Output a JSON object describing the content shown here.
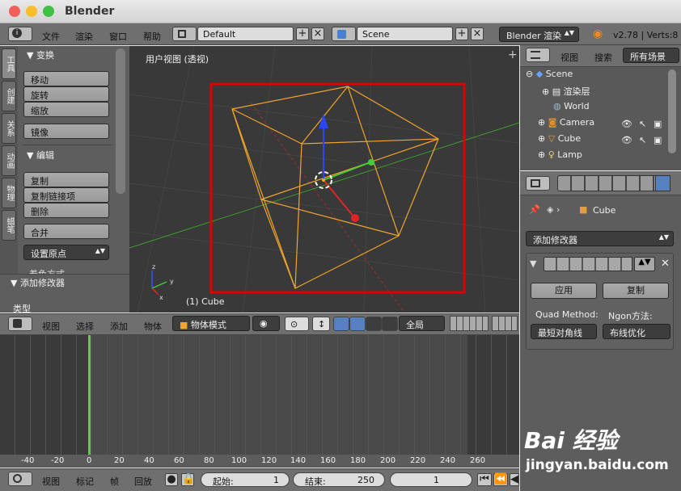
{
  "window": {
    "title": "Blender"
  },
  "colors": {
    "close": "#f25f58",
    "minimize": "#f9be2e",
    "maximize": "#3ec144",
    "selection": "#f2a52c",
    "red_box": "#e00000",
    "frame_cursor": "#5fd13a"
  },
  "top_menu": {
    "items": [
      "文件",
      "渲染",
      "窗口",
      "帮助"
    ],
    "layout": "Default",
    "scene": "Scene",
    "engine": "Blender 渲染",
    "version": "v2.78 | Verts:8"
  },
  "tool_shelf": {
    "tabs": [
      "工具",
      "创建",
      "关系",
      "动画",
      "物理",
      "蜡笔"
    ],
    "transform": {
      "title": "▼ 变换",
      "buttons": [
        "移动",
        "旋转",
        "缩放",
        "镜像"
      ]
    },
    "edit": {
      "title": "▼ 编辑",
      "buttons": [
        "复制",
        "复制链接项",
        "删除",
        "合并"
      ],
      "origin": "设置原点",
      "more": "着色方式"
    },
    "operator": {
      "title": "▼ 添加修改器",
      "type_label": "类型"
    }
  },
  "viewport": {
    "label": "用户视图 (透视)",
    "object": "(1) Cube"
  },
  "viewport_header": {
    "menus": [
      "视图",
      "选择",
      "添加",
      "物体"
    ],
    "mode": "物体模式",
    "orientation": "全局"
  },
  "timeline": {
    "ticks": [
      "-40",
      "-20",
      "0",
      "20",
      "40",
      "60",
      "80",
      "100",
      "120",
      "140",
      "160",
      "180",
      "200",
      "220",
      "240",
      "260"
    ],
    "current_frame": "0"
  },
  "timeline_header": {
    "menus": [
      "视图",
      "标记",
      "帧",
      "回放"
    ],
    "start": "起始:",
    "start_val": "1",
    "end": "结束:",
    "end_val": "250",
    "current": "1"
  },
  "outliner": {
    "view": "视图",
    "search": "搜索",
    "filter": "所有场景",
    "items": [
      "Scene",
      "渲染层",
      "World",
      "Camera",
      "Cube",
      "Lamp"
    ]
  },
  "properties": {
    "object": "Cube",
    "add_modifier": "添加修改器",
    "apply": "应用",
    "copy": "复制",
    "quad_label": "Quad Method:",
    "ngon_label": "Ngon方法:",
    "quad_value": "最短对角线",
    "ngon_value": "布线优化"
  },
  "watermark": {
    "brand": "Bai 经验",
    "url": "jingyan.baidu.com"
  }
}
